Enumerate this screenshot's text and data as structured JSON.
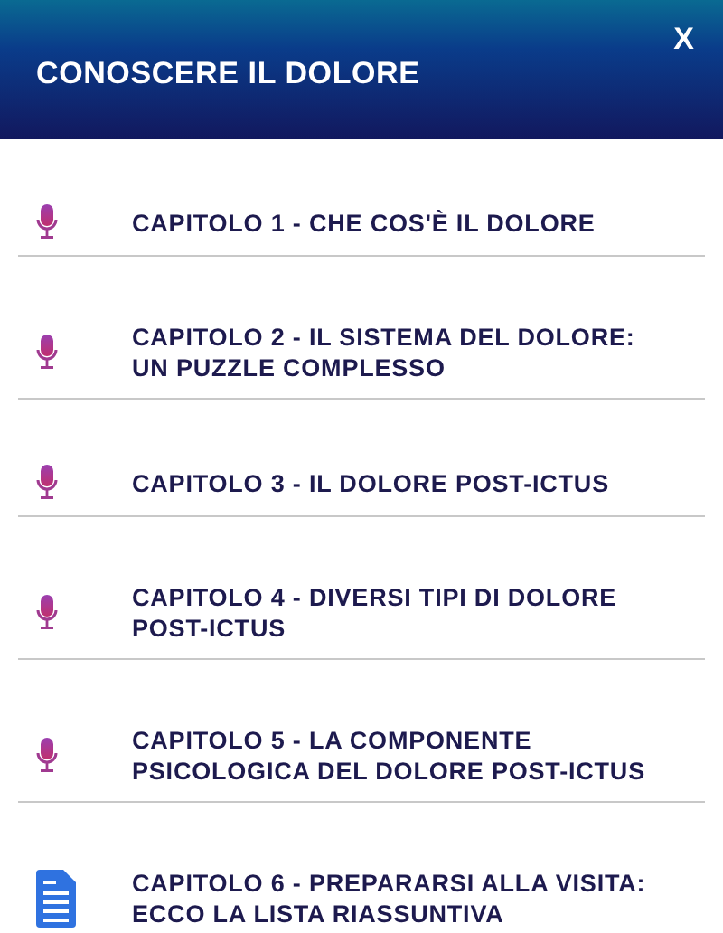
{
  "header": {
    "title": "CONOSCERE IL DOLORE",
    "close": "X"
  },
  "chapters": [
    {
      "kind": "audio",
      "title": "CAPITOLO 1 - CHE COS'È IL DOLORE"
    },
    {
      "kind": "audio",
      "title": "CAPITOLO 2 - IL SISTEMA DEL DOLORE: UN PUZZLE COMPLESSO"
    },
    {
      "kind": "audio",
      "title": "CAPITOLO 3 - IL DOLORE POST-ICTUS"
    },
    {
      "kind": "audio",
      "title": "CAPITOLO 4 - DIVERSI TIPI DI DOLORE POST-ICTUS"
    },
    {
      "kind": "audio",
      "title": "CAPITOLO 5 - LA COMPONENTE PSICOLOGICA DEL DOLORE POST-ICTUS"
    },
    {
      "kind": "document",
      "title": "CAPITOLO 6 - PREPARARSI ALLA VISITA: ECCO LA LISTA RIASSUNTIVA"
    }
  ]
}
